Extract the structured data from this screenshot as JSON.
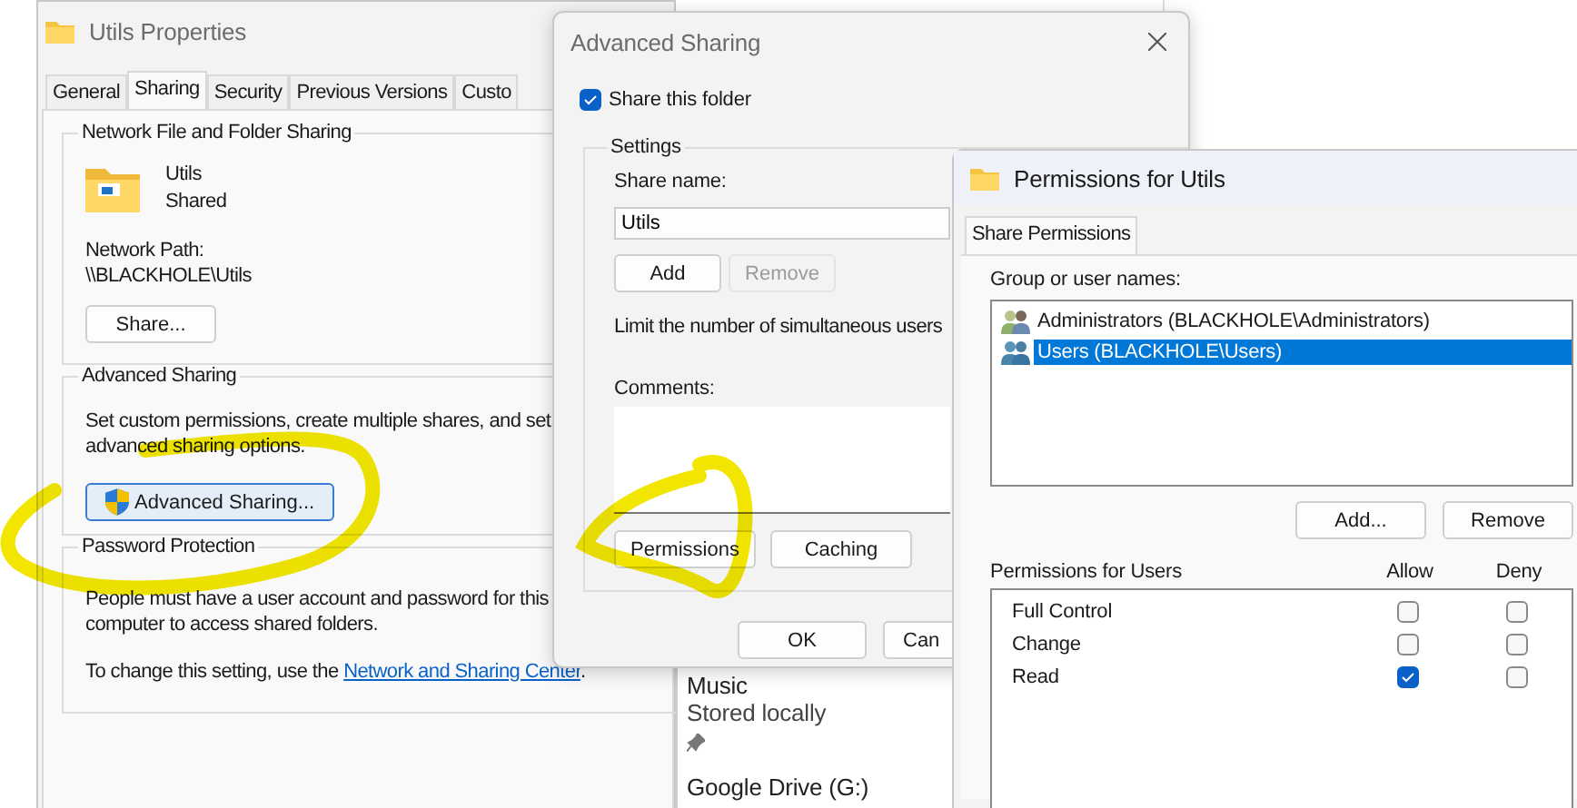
{
  "properties_window": {
    "title": "Utils Properties",
    "tabs": [
      {
        "label": "General",
        "selected": false
      },
      {
        "label": "Sharing",
        "selected": true
      },
      {
        "label": "Security",
        "selected": false
      },
      {
        "label": "Previous Versions",
        "selected": false
      },
      {
        "label": "Custo",
        "selected": false
      }
    ],
    "network_sharing": {
      "heading": "Network File and Folder Sharing",
      "folder_name": "Utils",
      "folder_status": "Shared",
      "path_label": "Network Path:",
      "path": "\\\\BLACKHOLE\\Utils",
      "share_button": "Share..."
    },
    "advanced_sharing": {
      "heading": "Advanced Sharing",
      "description_lines": [
        "Set custom permissions, create multiple shares, and set",
        "advanced sharing options."
      ],
      "button": "Advanced Sharing..."
    },
    "password_protection": {
      "heading": "Password Protection",
      "description_lines": [
        "People must have a user account and password for this",
        "computer to access shared folders."
      ],
      "link_prefix": "To change this setting, use the ",
      "link": "Network and Sharing Center",
      "link_suffix": "."
    }
  },
  "explorer_behind": {
    "items": [
      {
        "kind": "text",
        "label": "Music"
      },
      {
        "kind": "text",
        "label": "Stored locally"
      },
      {
        "kind": "pin"
      },
      {
        "kind": "text",
        "label": "Google Drive (G:)"
      }
    ]
  },
  "advanced_sharing_dialog": {
    "title": "Advanced Sharing",
    "share_this_folder": {
      "label": "Share this folder",
      "checked": true
    },
    "settings": {
      "heading": "Settings",
      "share_name_label": "Share name:",
      "share_name": "Utils",
      "add_button": {
        "label": "Add",
        "disabled": false
      },
      "remove_button": {
        "label": "Remove",
        "disabled": true
      },
      "limit_text": "Limit the number of simultaneous users",
      "comments_label": "Comments:",
      "permissions_button": "Permissions",
      "caching_button": "Caching"
    },
    "ok_button": "OK",
    "cancel_button": "Can"
  },
  "permissions_dialog": {
    "title": "Permissions for Utils",
    "tabs": [
      {
        "label": "Share Permissions",
        "selected": true
      }
    ],
    "group_label": "Group or user names:",
    "users": [
      {
        "name": "Administrators (BLACKHOLE\\Administrators)",
        "selected": false
      },
      {
        "name": "Users (BLACKHOLE\\Users)",
        "selected": true
      }
    ],
    "add_button": "Add...",
    "remove_button": "Remove",
    "permissions_label": "Permissions for Users",
    "allow_label": "Allow",
    "deny_label": "Deny",
    "permissions": [
      {
        "name": "Full Control",
        "allow": false,
        "deny": false
      },
      {
        "name": "Change",
        "allow": false,
        "deny": false
      },
      {
        "name": "Read",
        "allow": true,
        "deny": false
      }
    ]
  }
}
